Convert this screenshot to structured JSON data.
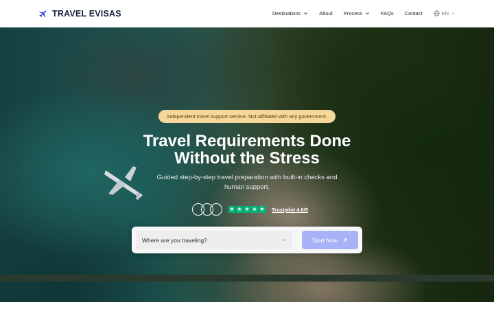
{
  "brand": {
    "name": "TRAVEL EVISAS",
    "logo_icon": "airplane-icon",
    "accent": "#1a2240"
  },
  "nav": {
    "items": [
      {
        "label": "Destinations",
        "dropdown": true
      },
      {
        "label": "About",
        "dropdown": false
      },
      {
        "label": "Process",
        "dropdown": true
      },
      {
        "label": "FAQs",
        "dropdown": false
      },
      {
        "label": "Contact",
        "dropdown": false
      }
    ],
    "language": "EN"
  },
  "hero": {
    "notice": "Independent travel support service. Not affiliated with any government.",
    "title_line1": "Travel Requirements Done",
    "title_line2": "Without the Stress",
    "subtitle_line1": "Guided step-by-step travel preparation with built-in checks and",
    "subtitle_line2": "human support.",
    "rating": {
      "stars": 5,
      "trustpilot_label": "Trustpilot 4.6/5",
      "star_color": "#00b67a"
    }
  },
  "search": {
    "select_placeholder": "Where are you traveling?",
    "button_label": "Start Now",
    "button_color": "#a7b3f6"
  }
}
